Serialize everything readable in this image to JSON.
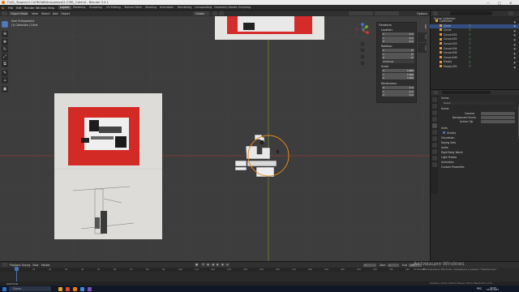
{
  "window": {
    "title": "F:\\АС_Задачи\\1.СоОбЛаб\\Исходники\\2.СЛИ\\_2.blend - Blender 3.4.1",
    "controls": [
      "—",
      "□",
      "✕"
    ]
  },
  "menubar": {
    "menus": [
      "File",
      "Edit",
      "Render",
      "Window",
      "Help"
    ],
    "workspaces": [
      "Layout",
      "Modeling",
      "Sculpting",
      "UV Editing",
      "Texture Paint",
      "Shading",
      "Animation",
      "Rendering",
      "Compositing",
      "Geometry Nodes",
      "Scripting"
    ],
    "active_workspace": "Layout"
  },
  "viewport_header": {
    "mode": "Object Mode",
    "menus": [
      "View",
      "Select",
      "Add",
      "Object"
    ],
    "transform": "Global",
    "options": "Options"
  },
  "viewport": {
    "info_line1": "User Orthographic",
    "info_line2": "(1) Collection | Circle"
  },
  "npanel": {
    "transform_title": "Transform",
    "location_title": "Location:",
    "location": [
      {
        "axis": "X",
        "val": "0 m"
      },
      {
        "axis": "Y",
        "val": "0 m"
      },
      {
        "axis": "Z",
        "val": "0 m"
      }
    ],
    "rotation_title": "Rotation:",
    "rotation": [
      {
        "axis": "X",
        "val": "0°"
      },
      {
        "axis": "Y",
        "val": "0°"
      },
      {
        "axis": "Z",
        "val": "0°"
      }
    ],
    "rotation_mode": "XYZ Euler",
    "scale_title": "Scale:",
    "scale": [
      {
        "axis": "X",
        "val": "1.000"
      },
      {
        "axis": "Y",
        "val": "1.000"
      },
      {
        "axis": "Z",
        "val": "1.000"
      }
    ],
    "dimensions_title": "Dimensions:",
    "dimensions": [
      {
        "axis": "X",
        "val": "2 m"
      },
      {
        "axis": "Y",
        "val": "2 m"
      },
      {
        "axis": "Z",
        "val": "0 m"
      }
    ],
    "tabs": [
      "Item",
      "Tool",
      "View"
    ]
  },
  "outliner": {
    "title": "Scene Collection",
    "items": [
      {
        "name": "Collection",
        "sel": false
      },
      {
        "name": "Circle",
        "sel": true
      },
      {
        "name": "Curve",
        "sel": false
      },
      {
        "name": "Curve.001",
        "sel": false
      },
      {
        "name": "Curve.002",
        "sel": false
      },
      {
        "name": "Curve.003",
        "sel": false
      },
      {
        "name": "Curve.004",
        "sel": false
      },
      {
        "name": "Curve.005",
        "sel": false
      },
      {
        "name": "Curve.006",
        "sel": false
      },
      {
        "name": "Empty",
        "sel": false
      },
      {
        "name": "Empty.001",
        "sel": false
      }
    ]
  },
  "properties": {
    "search_placeholder": "",
    "scene_label": "Scene",
    "scene_section": "Scene",
    "camera_label": "Camera",
    "background_label": "Background Scene",
    "active_clip_label": "Active Clip",
    "units_section": "Units",
    "gravity_label": "Gravity",
    "sections": [
      "Simulation",
      "Keying Sets",
      "Audio",
      "Rigid Body World",
      "Light Probes",
      "Animation",
      "Custom Properties"
    ]
  },
  "timeline": {
    "menus": [
      "Playback",
      "Keying",
      "View",
      "Marker"
    ],
    "current_frame": "1",
    "start_label": "Start",
    "start": "1",
    "end_label": "End",
    "end": "250",
    "ruler": [
      "0",
      "10",
      "20",
      "30",
      "40",
      "50",
      "60",
      "70",
      "80",
      "90",
      "100",
      "110",
      "120",
      "130",
      "140",
      "150",
      "160",
      "170",
      "180",
      "190",
      "200",
      "210",
      "220",
      "230",
      "240",
      "250"
    ]
  },
  "status": {
    "left": "Add Circle",
    "right": "Collection | Circle | Verts:0 | Faces:0 | Tris:0 | Objects:1/11 | 3.4.1"
  },
  "watermark": {
    "title": "Активация Windows",
    "subtitle": "Чтобы активировать Windows, перейдите в раздел \"Параметры\"."
  },
  "taskbar": {
    "search_placeholder": "Поиск",
    "clock": "16:25",
    "date": "14.02.2023",
    "lang": "РУС"
  }
}
